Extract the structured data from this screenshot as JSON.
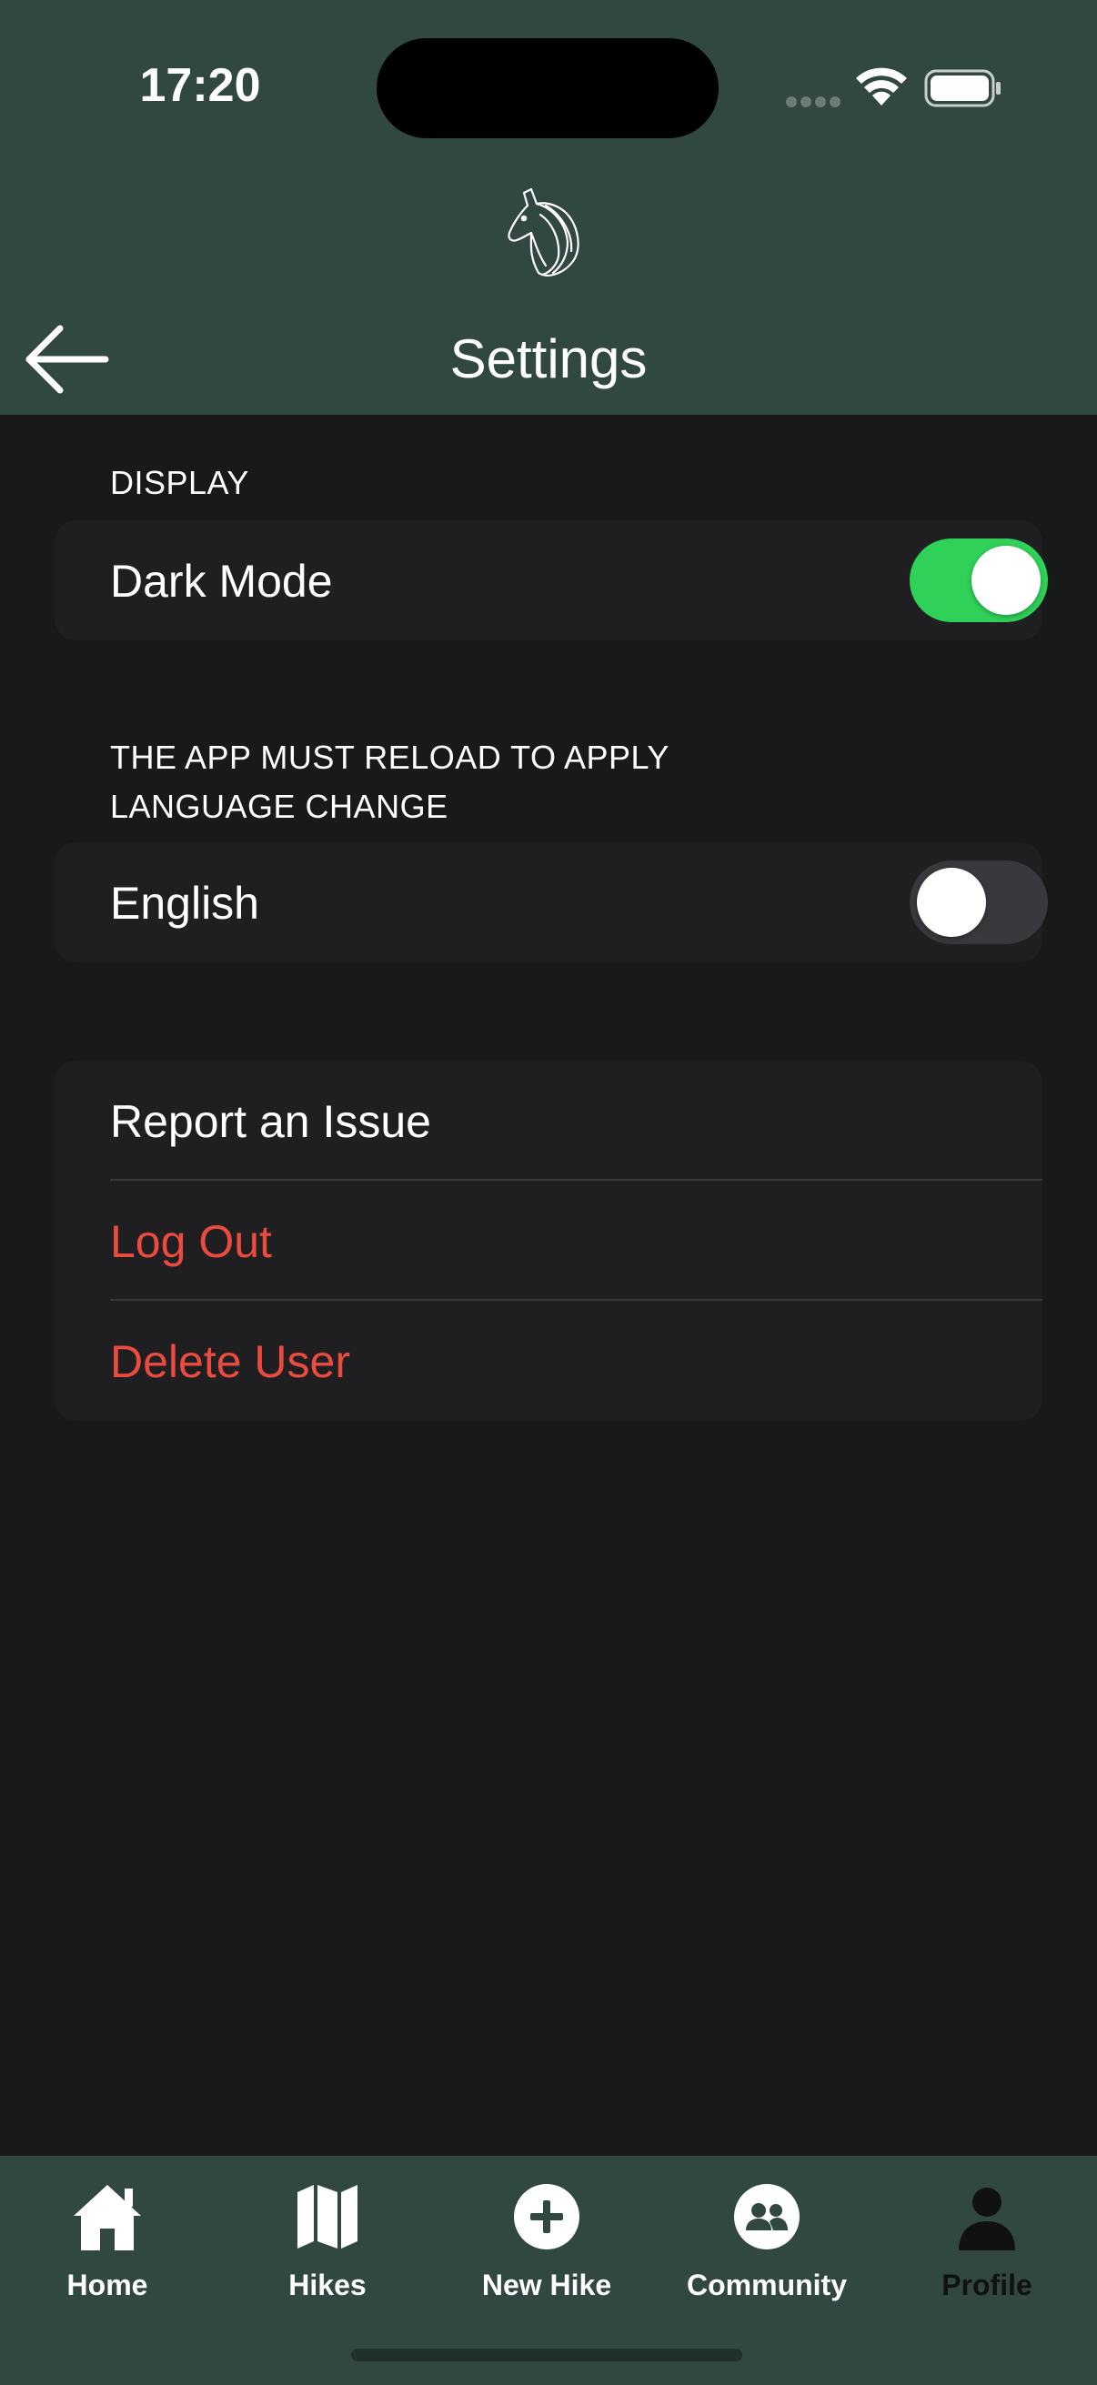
{
  "status_bar": {
    "time": "17:20"
  },
  "header": {
    "title": "Settings"
  },
  "display_section": {
    "label": "DISPLAY",
    "dark_mode": {
      "label": "Dark Mode",
      "on": true
    }
  },
  "language_section": {
    "label_line1": "THE APP MUST RELOAD TO APPLY",
    "label_line2": "LANGUAGE CHANGE",
    "english": {
      "label": "English",
      "on": false
    }
  },
  "actions": {
    "report_issue": "Report an Issue",
    "log_out": "Log Out",
    "delete_user": "Delete User"
  },
  "tabs": [
    {
      "label": "Home",
      "icon": "house-icon",
      "active": false
    },
    {
      "label": "Hikes",
      "icon": "map-icon",
      "active": false
    },
    {
      "label": "New Hike",
      "icon": "plus-circle-icon",
      "active": false
    },
    {
      "label": "Community",
      "icon": "people-circle-icon",
      "active": false
    },
    {
      "label": "Profile",
      "icon": "person-icon",
      "active": true
    }
  ],
  "colors": {
    "header_bg": "#304841",
    "page_bg": "#181919",
    "card_bg": "#1f1f21",
    "toggle_on": "#30d158",
    "toggle_off": "#39393d",
    "destructive": "#eb4b3f",
    "active_tab": "#111111"
  }
}
